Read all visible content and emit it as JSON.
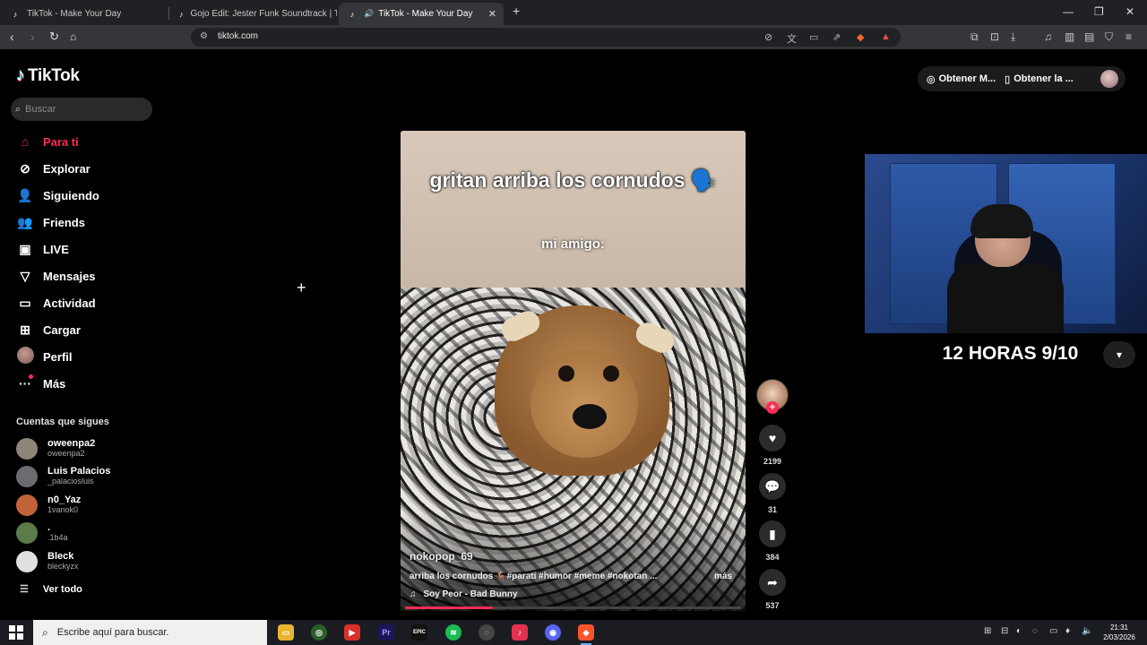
{
  "browser": {
    "tabs": [
      {
        "title": "TikTok - Make Your Day",
        "active": false
      },
      {
        "title": "Gojo Edit: Jester Funk Soundtrack | T",
        "active": false
      },
      {
        "title": "TikTok - Make Your Day",
        "active": true
      }
    ],
    "new_tab": "+",
    "url": "tiktok.com",
    "window_controls": {
      "minimize": "—",
      "maximize": "❐",
      "close": "✕"
    }
  },
  "tiktok": {
    "logo": "TikTok",
    "search_placeholder": "Buscar",
    "nav": [
      {
        "label": "Para ti",
        "icon": "home-icon",
        "active": true
      },
      {
        "label": "Explorar",
        "icon": "compass-icon"
      },
      {
        "label": "Siguiendo",
        "icon": "user-follow-icon"
      },
      {
        "label": "Friends",
        "icon": "friends-icon"
      },
      {
        "label": "LIVE",
        "icon": "live-icon"
      },
      {
        "label": "Mensajes",
        "icon": "send-icon"
      },
      {
        "label": "Actividad",
        "icon": "activity-icon"
      },
      {
        "label": "Cargar",
        "icon": "upload-icon"
      },
      {
        "label": "Perfil",
        "icon": "avatar"
      },
      {
        "label": "Más",
        "icon": "more-icon"
      }
    ],
    "following_title": "Cuentas que sigues",
    "following": [
      {
        "name": "oweenpa2",
        "user": "oweenpa2",
        "color": "#8c8578"
      },
      {
        "name": "Luis Palacios",
        "user": "_palaciosluis",
        "color": "#6d6a70"
      },
      {
        "name": "n0_Yaz",
        "user": "1vanok0",
        "color": "#c1623a"
      },
      {
        "name": ".",
        "user": ".1b4a",
        "color": "#5c7a4a"
      },
      {
        "name": "Bleck",
        "user": "bleckyzx",
        "color": "#e0e0e0"
      }
    ],
    "see_all": "Ver todo",
    "top_right": {
      "btn1": "Obtener M...",
      "btn2": "Obtener la ..."
    },
    "video": {
      "caption_top": "gritan arriba los cornudos 🗣️",
      "caption_mid": "mi amigo:",
      "author": "nokopop_69",
      "description": "arriba los cornudos 🦌#parati #humor #meme #nokotan ...",
      "more": "más",
      "music": "Soy Peor - Bad Bunny",
      "progress": 0.26
    },
    "actions": {
      "likes": "2199",
      "comments": "31",
      "saves": "384",
      "shares": "537"
    }
  },
  "webcam": {
    "title": "12 HORAS 9/10"
  },
  "taskbar": {
    "search_placeholder": "Escribe aquí para buscar.",
    "time": "21:31",
    "date": "2/03/2026"
  },
  "colors": {
    "accent": "#fe2c55",
    "background": "#000000"
  }
}
